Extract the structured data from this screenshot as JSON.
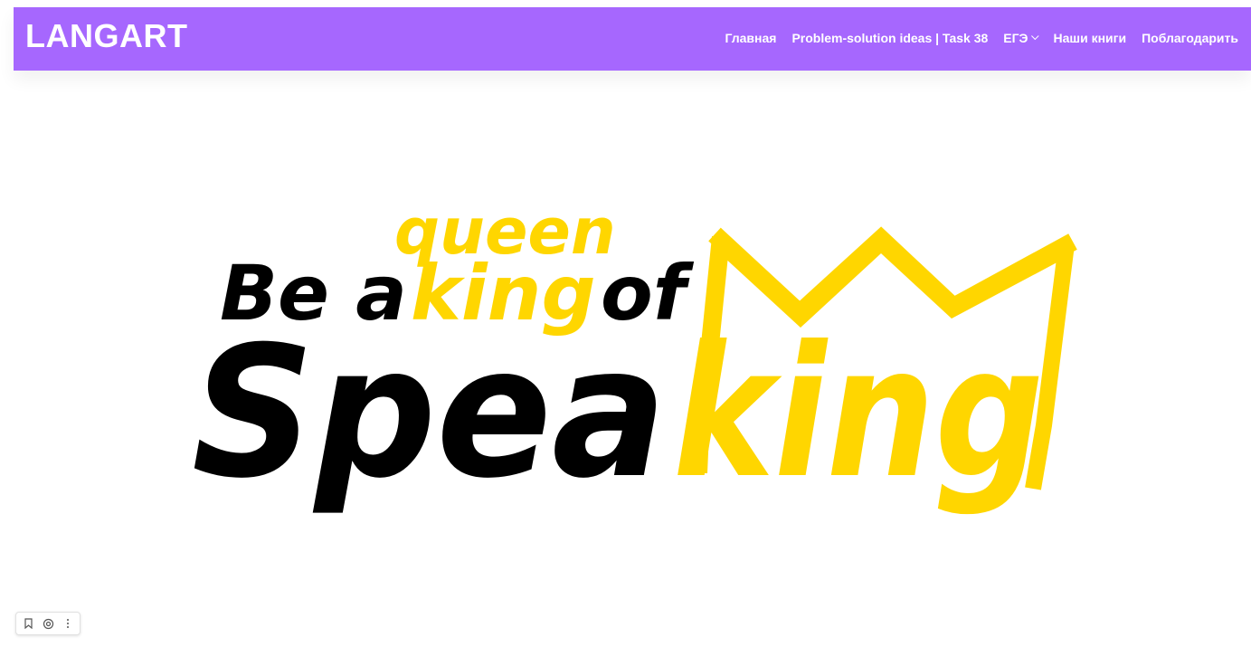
{
  "header": {
    "brand": "LANGART",
    "background_color": "#a667fe",
    "nav": [
      {
        "label": "Главная"
      },
      {
        "label": "Problem-solution ideas | Task 38"
      },
      {
        "label": "ЕГЭ",
        "has_dropdown": true
      },
      {
        "label": "Наши книги"
      },
      {
        "label": "Поблагодарить"
      }
    ]
  },
  "hero": {
    "logo": {
      "line1_prefix": "Be a",
      "line1_alt": "queen",
      "line1_highlight": "king",
      "line1_suffix": "of",
      "line2_prefix": "Spea",
      "line2_highlight": "king",
      "primary_color": "#000000",
      "accent_color": "#ffd600",
      "decoration": "crown"
    }
  },
  "mini_toolbar": {
    "icons": [
      "bookmark-icon",
      "at-sign-icon",
      "more-vertical-icon"
    ]
  }
}
